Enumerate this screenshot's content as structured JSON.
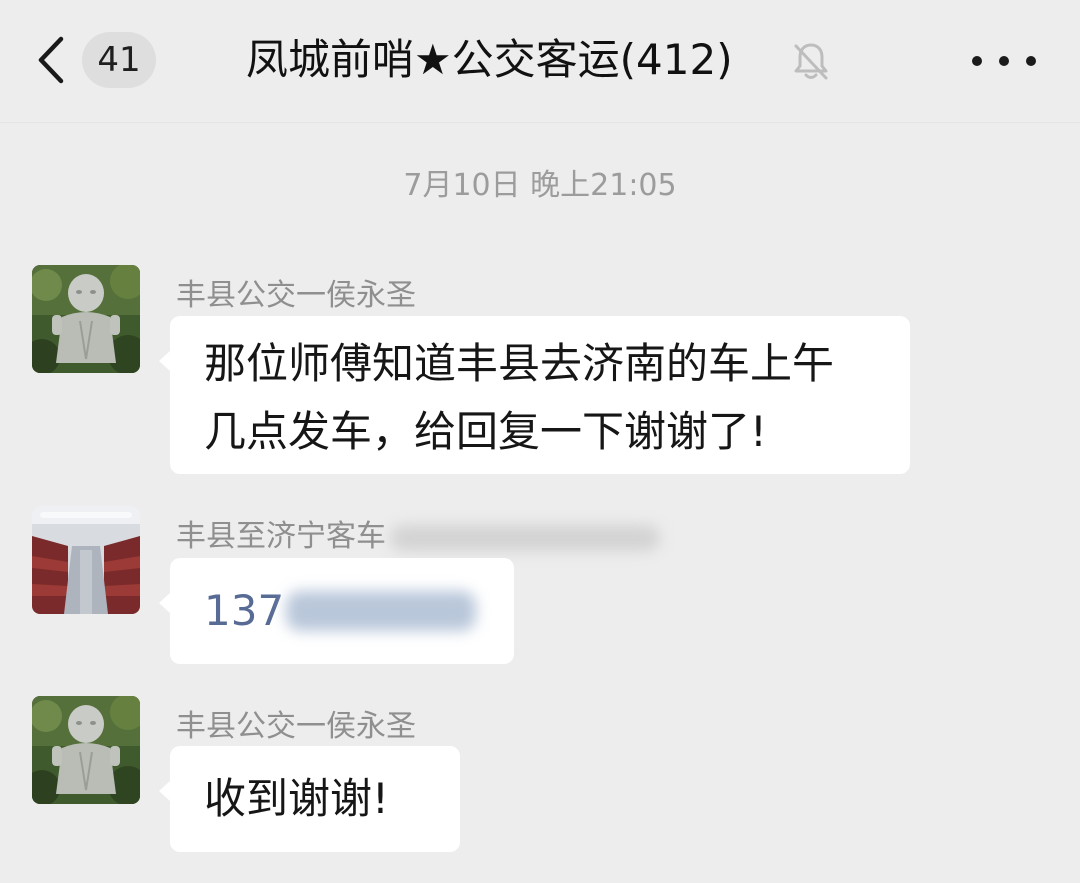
{
  "header": {
    "unread_count": "41",
    "title": "凤城前哨★公交客运(412)"
  },
  "timestamp": "7月10日 晚上21:05",
  "messages": [
    {
      "sender": "丰县公交一侯永圣",
      "lines": [
        "那位师傅知道丰县去济南的车上午",
        "几点发车，给回复一下谢谢了!"
      ]
    },
    {
      "sender": "丰县至济宁客车",
      "text": "137"
    },
    {
      "sender": "丰县公交一侯永圣",
      "text": "收到谢谢!"
    }
  ],
  "icons": {
    "back": "chevron-left-icon",
    "mute": "bell-off-icon",
    "more": "more-dots-icon"
  },
  "colors": {
    "background": "#ededed",
    "bubble": "#ffffff",
    "link": "#576b95",
    "meta_text": "#9c9c9c"
  }
}
